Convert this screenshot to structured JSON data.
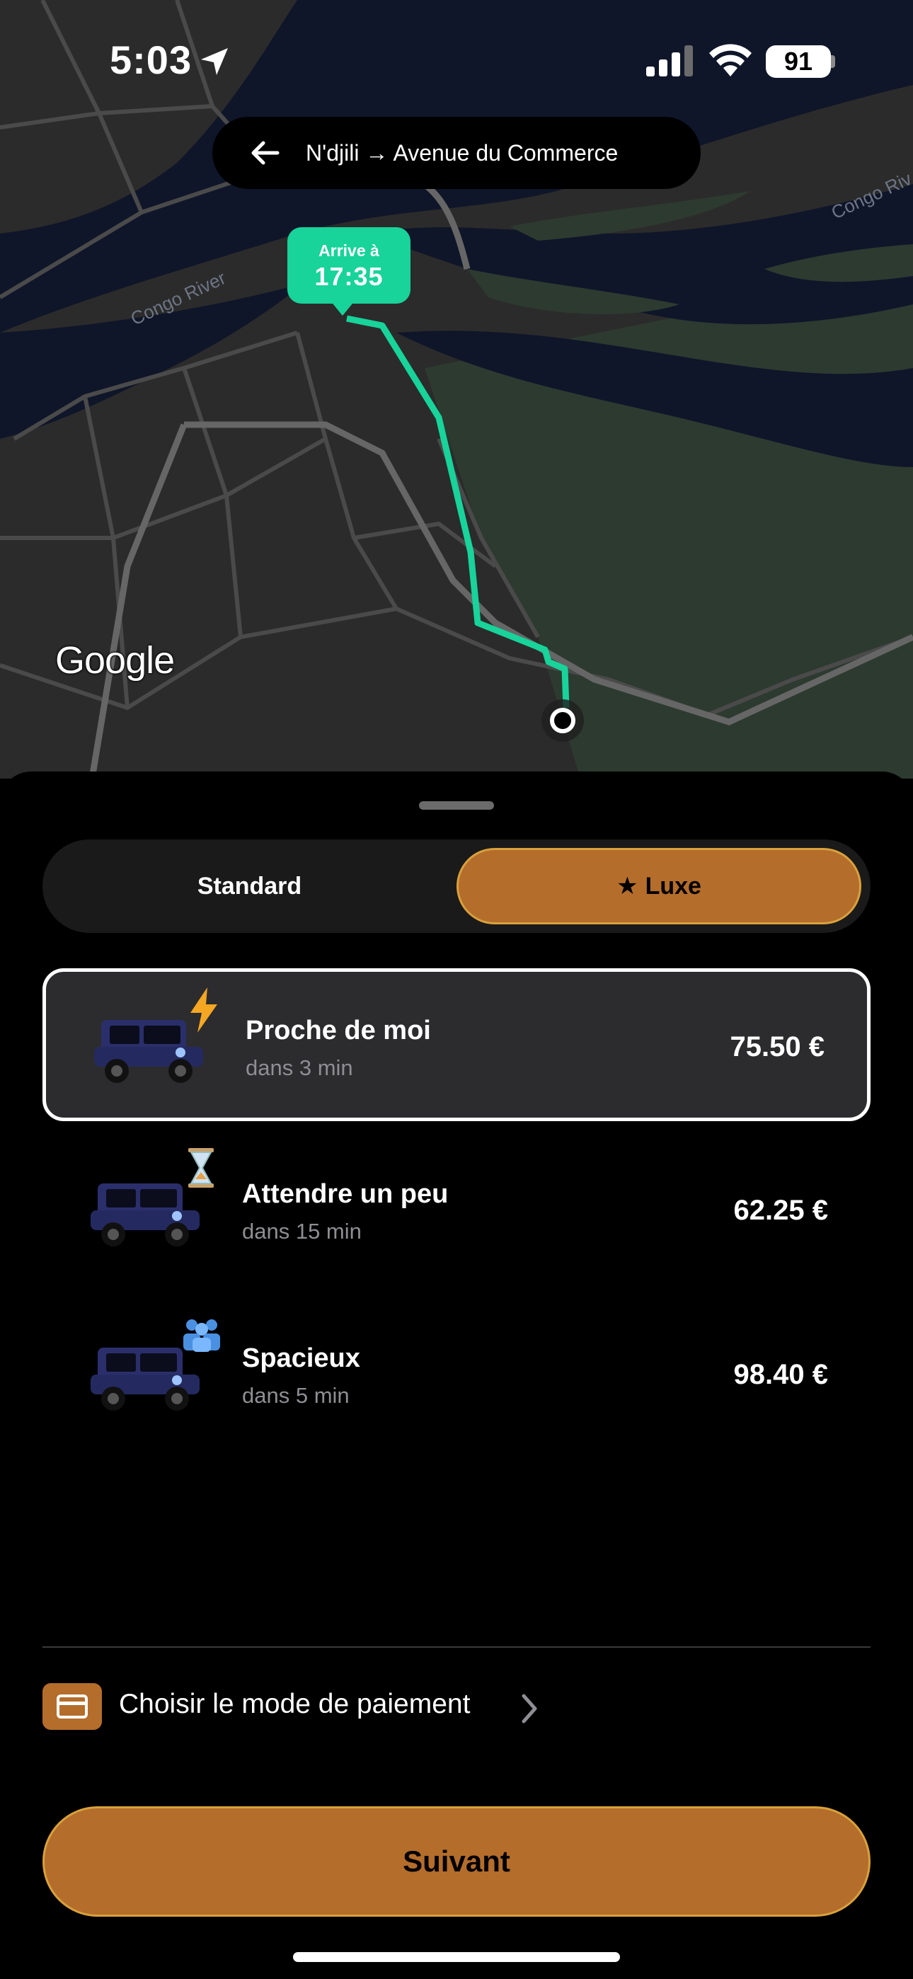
{
  "status_bar": {
    "time": "5:03",
    "battery": "91"
  },
  "route": {
    "text": "N'djili → Avenue du Commerce"
  },
  "map": {
    "eta_label": "Arrive à",
    "eta_time": "17:35",
    "river_label_1": "Congo River",
    "river_label_2": "Congo Riv",
    "provider": "Google"
  },
  "tabs": {
    "standard": "Standard",
    "luxe": "Luxe",
    "selected": "Luxe"
  },
  "options": [
    {
      "title": "Proche de moi",
      "eta": "dans 3 min",
      "price": "75.50 €",
      "badge_icon": "lightning-icon",
      "selected": true
    },
    {
      "title": "Attendre un peu",
      "eta": "dans 15 min",
      "price": "62.25 €",
      "badge_icon": "hourglass-icon",
      "selected": false
    },
    {
      "title": "Spacieux",
      "eta": "dans 5 min",
      "price": "98.40 €",
      "badge_icon": "people-icon",
      "selected": false
    }
  ],
  "payment": {
    "label": "Choisir le mode de paiement"
  },
  "next_button": "Suivant",
  "colors": {
    "accent": "#b46d2b",
    "route": "#18d39a",
    "water": "#0f1629",
    "land_green": "#2d3a30"
  }
}
